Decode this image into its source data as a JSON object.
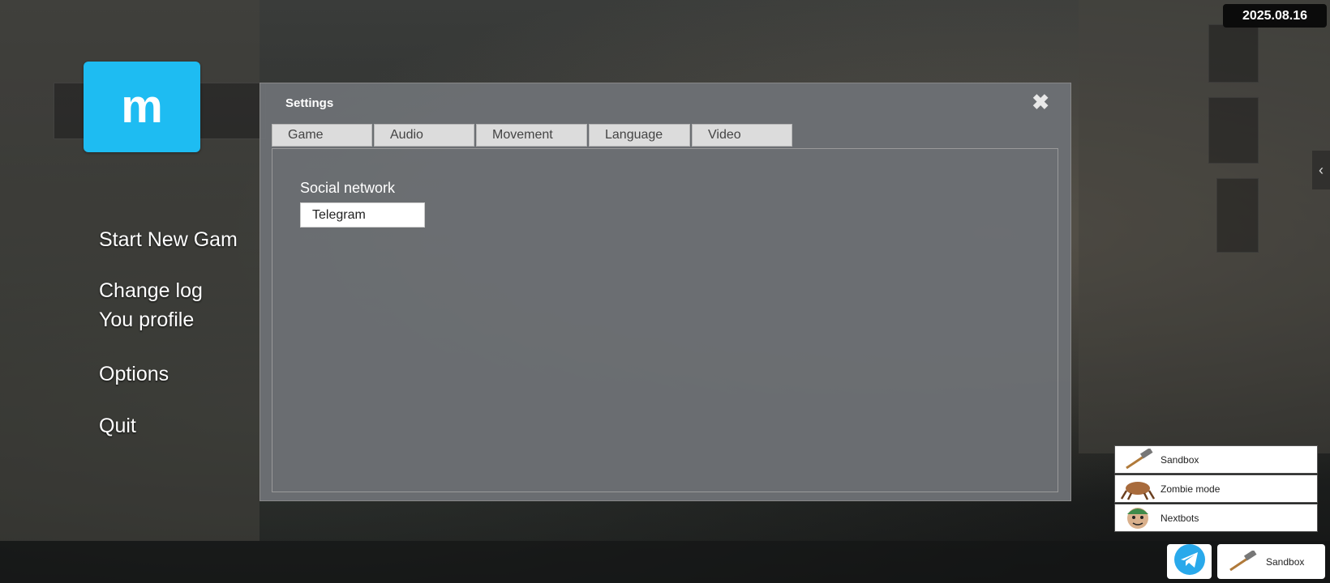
{
  "date_badge": "2025.08.16",
  "logo": {
    "letter": "m",
    "color": "#1ebcf2"
  },
  "main_menu": {
    "start_new_game": "Start New Gam",
    "change_log": "Change log",
    "profile": "You profile",
    "options": "Options",
    "quit": "Quit"
  },
  "settings_dialog": {
    "title": "Settings",
    "close_icon": "close-icon",
    "tabs": [
      {
        "label": "Game"
      },
      {
        "label": "Audio"
      },
      {
        "label": "Movement"
      },
      {
        "label": "Language"
      },
      {
        "label": "Video"
      }
    ],
    "active_tab": "Game",
    "social_network": {
      "label": "Social network",
      "selected": "Telegram"
    }
  },
  "game_modes": [
    {
      "label": "Sandbox",
      "icon": "hammer-icon"
    },
    {
      "label": "Zombie mode",
      "icon": "headcrab-icon"
    },
    {
      "label": "Nextbots",
      "icon": "nextbot-face-icon"
    }
  ],
  "bottom_buttons": {
    "telegram_icon": "telegram-icon",
    "sandbox_label": "Sandbox"
  },
  "colors": {
    "telegram": "#29a9eb",
    "dialog_bg": "#6c7074"
  }
}
